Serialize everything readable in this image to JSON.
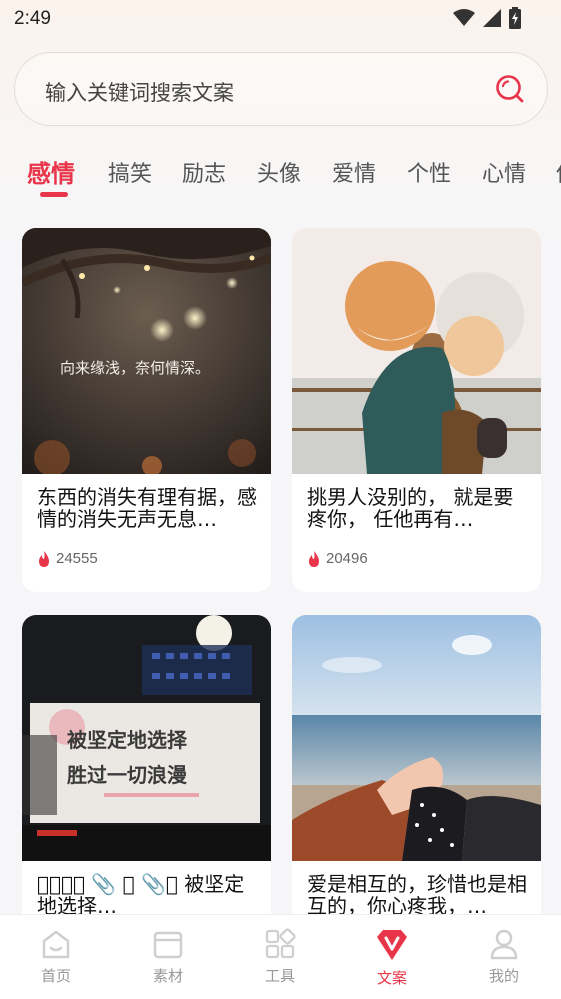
{
  "status": {
    "time": "2:49"
  },
  "search": {
    "placeholder": "输入关键词搜索文案"
  },
  "tabs": [
    {
      "label": "感情",
      "active": true
    },
    {
      "label": "搞笑"
    },
    {
      "label": "励志"
    },
    {
      "label": "头像"
    },
    {
      "label": "爱情"
    },
    {
      "label": "个性"
    },
    {
      "label": "心情"
    },
    {
      "label": "伤"
    }
  ],
  "cards": [
    {
      "title": "东西的消失有理有据，感情的消失无声无息…",
      "count": "24555",
      "image_caption": "向来缘浅，奈何情深。"
    },
    {
      "title": "挑男人没别的， 就是要疼你， 任他再有…",
      "count": "20496"
    },
    {
      "title": "􀀀􀀀􀀀􀀀 📎       􀀀 📎􀀀 被坚定地选择…",
      "count": "",
      "image_caption_line1": "被坚定地选择",
      "image_caption_line2": "胜过一切浪漫"
    },
    {
      "title": "爱是相互的，珍惜也是相互的，你心疼我，…",
      "count": ""
    }
  ],
  "nav": [
    {
      "label": "首页",
      "icon": "home-icon"
    },
    {
      "label": "素材",
      "icon": "folder-icon"
    },
    {
      "label": "工具",
      "icon": "tools-icon"
    },
    {
      "label": "文案",
      "icon": "copywriting-icon",
      "active": true
    },
    {
      "label": "我的",
      "icon": "profile-icon"
    }
  ],
  "colors": {
    "accent": "#e8354a",
    "nav_inactive": "#999999"
  }
}
